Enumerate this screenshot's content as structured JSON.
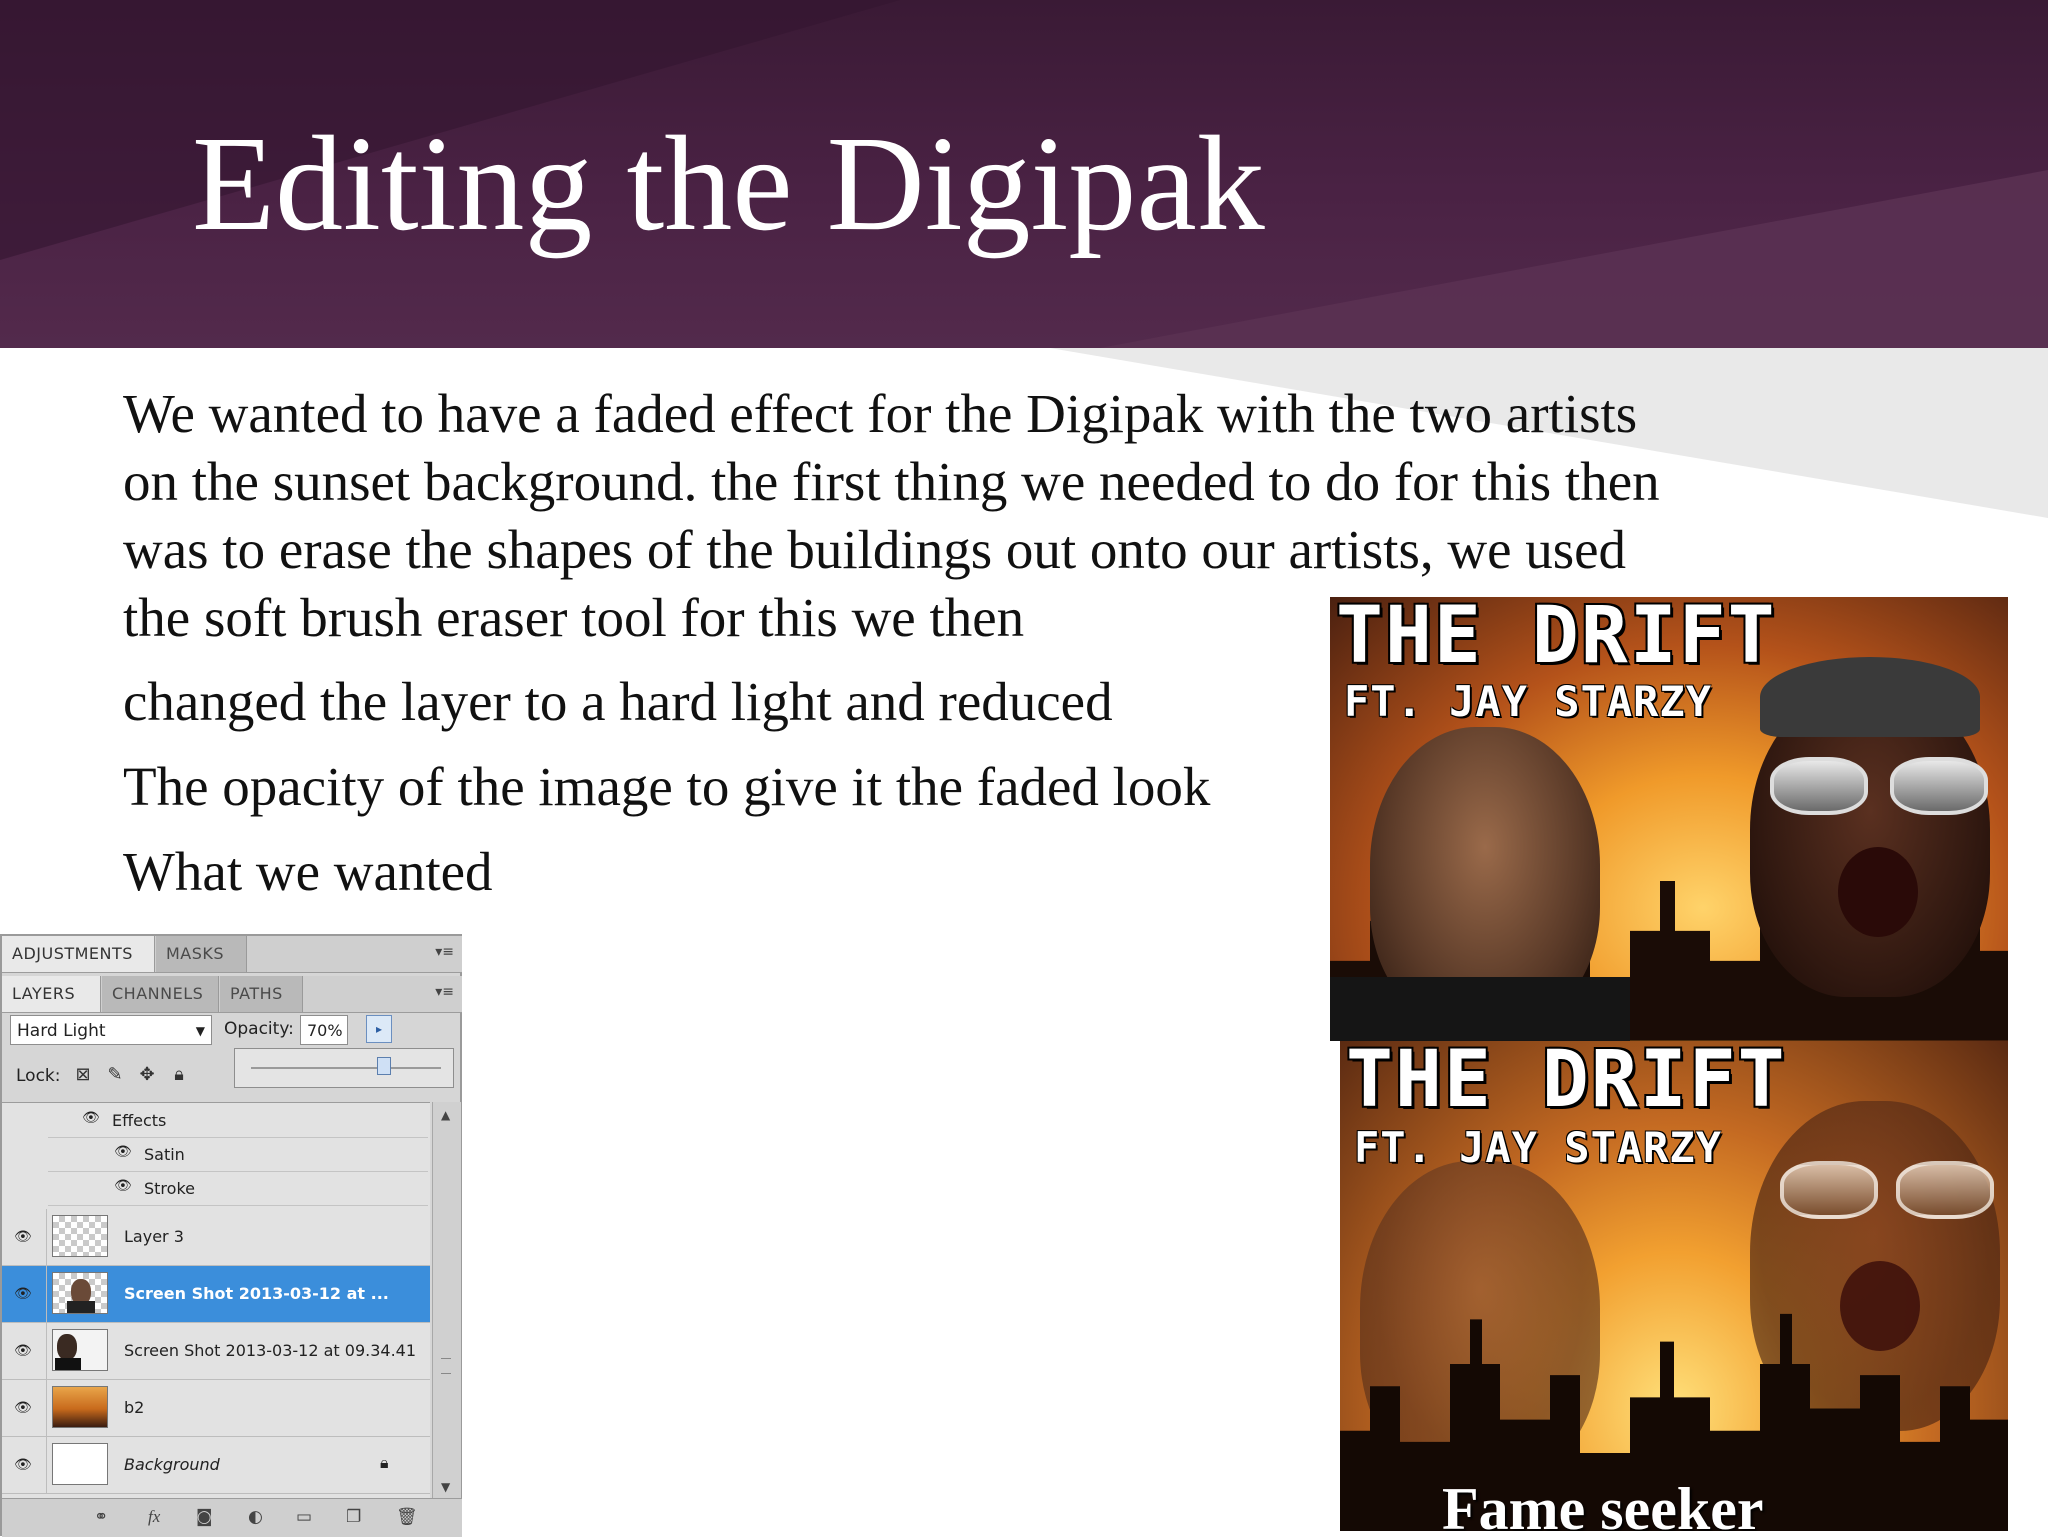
{
  "slide": {
    "title": "Editing the Digipak",
    "body_lines": [
      "We wanted to have a faded  effect for the Digipak with the two artists",
      "on the sunset background. the first thing  we needed to do for this then",
      "was to erase the shapes of the buildings out onto our artists, we used",
      "the soft brush eraser tool for this we then",
      "changed the layer to a hard light and reduced",
      "The opacity of the image to give it the faded look",
      "What we wanted"
    ],
    "colors": {
      "header": "#4a2244",
      "text": "#111111"
    }
  },
  "photoshop_panel": {
    "top_tabs": [
      "ADJUSTMENTS",
      "MASKS"
    ],
    "layer_tabs": [
      "LAYERS",
      "CHANNELS",
      "PATHS"
    ],
    "blend_mode": "Hard Light",
    "opacity_label": "Opacity:",
    "opacity_value": "70%",
    "opacity_level": 0.7,
    "lock_label": "Lock:",
    "effects": {
      "label": "Effects",
      "items": [
        "Satin",
        "Stroke"
      ]
    },
    "layers": [
      {
        "name": "Layer 3",
        "selected": false,
        "thumb": "transparent"
      },
      {
        "name": "Screen Shot 2013-03-12 at ...",
        "selected": true,
        "thumb": "portrait"
      },
      {
        "name": "Screen Shot 2013-03-12 at 09.34.41",
        "selected": false,
        "thumb": "portrait"
      },
      {
        "name": "b2",
        "selected": false,
        "thumb": "sunset"
      },
      {
        "name": "Background",
        "selected": false,
        "thumb": "white",
        "locked": true
      }
    ],
    "bottom_icons": [
      "link-icon",
      "fx-icon",
      "mask-icon",
      "adjustment-icon",
      "folder-icon",
      "new-layer-icon",
      "trash-icon"
    ],
    "colors": {
      "selection": "#3b8edb",
      "panel": "#d6d6d6"
    }
  },
  "album_art": {
    "title": "THE DRIFT",
    "subtitle": "FT. JAY STARZY",
    "tagline": "Fame seeker"
  }
}
